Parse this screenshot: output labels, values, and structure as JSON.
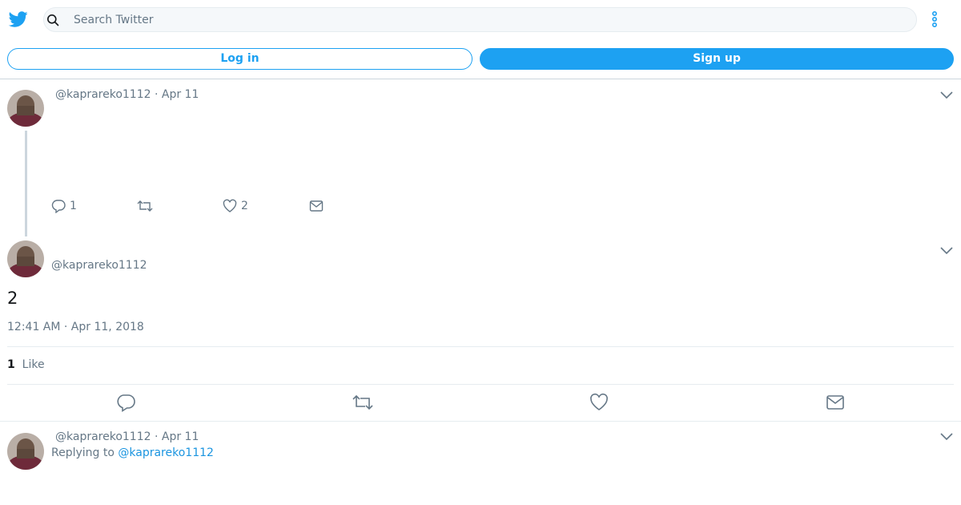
{
  "header": {
    "logo_icon": "twitter-bird-icon",
    "search_placeholder": "Search Twitter",
    "more_icon": "more-vertical-icon",
    "brand_color": "#1da1f2"
  },
  "auth": {
    "login_label": "Log in",
    "signup_label": "Sign up"
  },
  "tweet1": {
    "handle": "@kaprareko1112",
    "separator": "·",
    "date": "Apr 11",
    "reply_count": "1",
    "retweet_count": "",
    "like_count": "2"
  },
  "main_tweet": {
    "handle": "@kaprareko1112",
    "text": "2",
    "timestamp": "12:41 AM · Apr 11, 2018",
    "likes_count": "1",
    "likes_label": "Like"
  },
  "tweet3": {
    "handle": "@kaprareko1112",
    "separator": "·",
    "date": "Apr 11",
    "replying_prefix": "Replying to",
    "replying_handle": "@kaprareko1112"
  }
}
